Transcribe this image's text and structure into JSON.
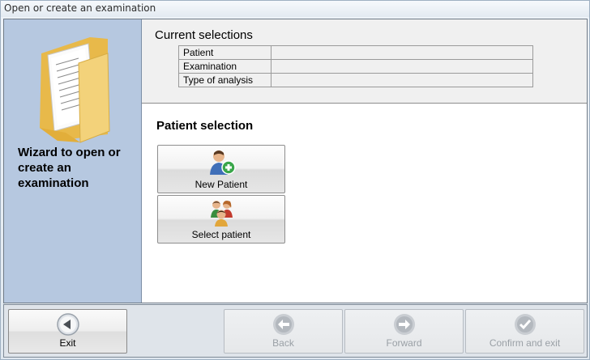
{
  "window": {
    "title": "Open or create an examination"
  },
  "wizard": {
    "title": "Wizard to open or create an examination"
  },
  "current_selections": {
    "title": "Current selections",
    "rows": [
      {
        "label": "Patient",
        "value": ""
      },
      {
        "label": "Examination",
        "value": ""
      },
      {
        "label": "Type of analysis",
        "value": ""
      }
    ]
  },
  "patient_selection": {
    "title": "Patient selection",
    "new_patient_label": "New Patient",
    "select_patient_label": "Select patient"
  },
  "footer": {
    "exit_label": "Exit",
    "back_label": "Back",
    "forward_label": "Forward",
    "confirm_label": "Confirm and exit"
  },
  "icons": {
    "folder": "folder-icon",
    "new_patient": "add-patient-icon",
    "select_patient": "patients-group-icon",
    "exit": "arrow-left-icon",
    "back": "arrow-left-icon",
    "forward": "arrow-right-icon",
    "confirm": "checkmark-icon"
  },
  "colors": {
    "left_panel": "#b6c8e0",
    "folder_yellow": "#f3d27a",
    "add_green": "#3aa64a"
  }
}
